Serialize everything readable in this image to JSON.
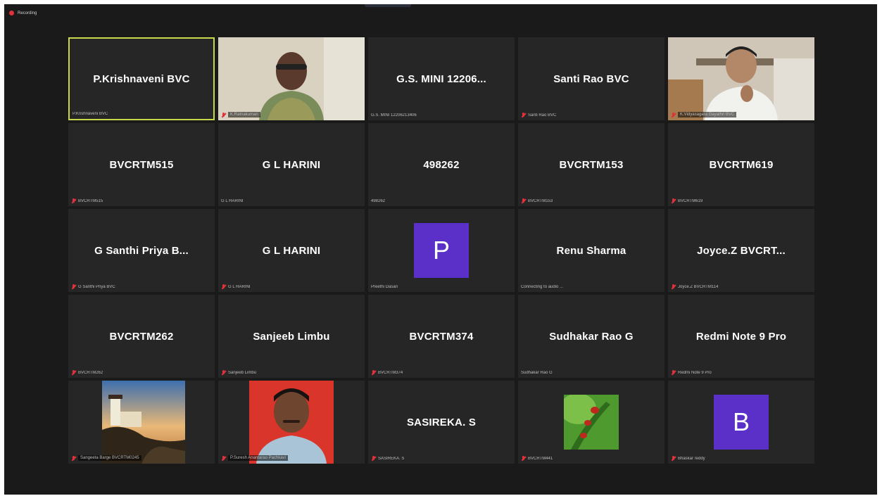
{
  "recording": {
    "label": "Recording"
  },
  "colors": {
    "active_speaker_border": "#c9d84a",
    "avatar": "#5b30c9",
    "muted": "#e0323c",
    "tile": "#262626"
  },
  "tiles": [
    {
      "name": "P.Krishnaveni BVC",
      "label": "P.Krishnaveni BVC",
      "muted": false
    },
    {
      "name": "",
      "label": "K.Ratnakumari",
      "muted": true
    },
    {
      "name": "G.S. MINI 12206...",
      "label": "G.S. MINI 12206213406",
      "muted": false
    },
    {
      "name": "Santi Rao BVC",
      "label": "Santi Rao BVC",
      "muted": true
    },
    {
      "name": "",
      "label": "K.Vidyasagara Gayathri BVC",
      "muted": true
    },
    {
      "name": "BVCRTM515",
      "label": "BVCRTM515",
      "muted": true
    },
    {
      "name": "G L HARINI",
      "label": "G L HARINI",
      "muted": false
    },
    {
      "name": "498262",
      "label": "498262",
      "muted": false
    },
    {
      "name": "BVCRTM153",
      "label": "BVCRTM153",
      "muted": true
    },
    {
      "name": "BVCRTM619",
      "label": "BVCRTM619",
      "muted": true
    },
    {
      "name": "G Santhi Priya B...",
      "label": "G Santhi Priya BVC",
      "muted": true
    },
    {
      "name": "G L HARINI",
      "label": "G L HARINI",
      "muted": true
    },
    {
      "name": "",
      "avatar": "P",
      "label": "Preethi Dasari",
      "muted": false
    },
    {
      "name": "Renu Sharma",
      "label": "Connecting to audio ...",
      "muted": false
    },
    {
      "name": "Joyce.Z   BVCRT...",
      "label": "Joyce.Z   BVCRTM114",
      "muted": true
    },
    {
      "name": "BVCRTM262",
      "label": "BVCRTM262",
      "muted": true
    },
    {
      "name": "Sanjeeb Limbu",
      "label": "Sanjeeb Limbu",
      "muted": true
    },
    {
      "name": "BVCRTM374",
      "label": "BVCRTM374",
      "muted": true
    },
    {
      "name": "Sudhakar Rao G",
      "label": "Sudhakar Rao G",
      "muted": false
    },
    {
      "name": "Redmi Note 9 Pro",
      "label": "Redmi Note 9 Pro",
      "muted": true
    },
    {
      "name": "",
      "label": "Sangeeta Barge BVCRTM0245",
      "muted": true
    },
    {
      "name": "",
      "label": "P.Suresh Anantarao Pachkavi",
      "muted": true
    },
    {
      "name": "SASIREKA. S",
      "label": "SASIREKA. S",
      "muted": true
    },
    {
      "name": "",
      "label": "BVCRTM441",
      "muted": true
    },
    {
      "name": "",
      "avatar": "B",
      "label": "Bhaskar reddy",
      "muted": true
    }
  ]
}
